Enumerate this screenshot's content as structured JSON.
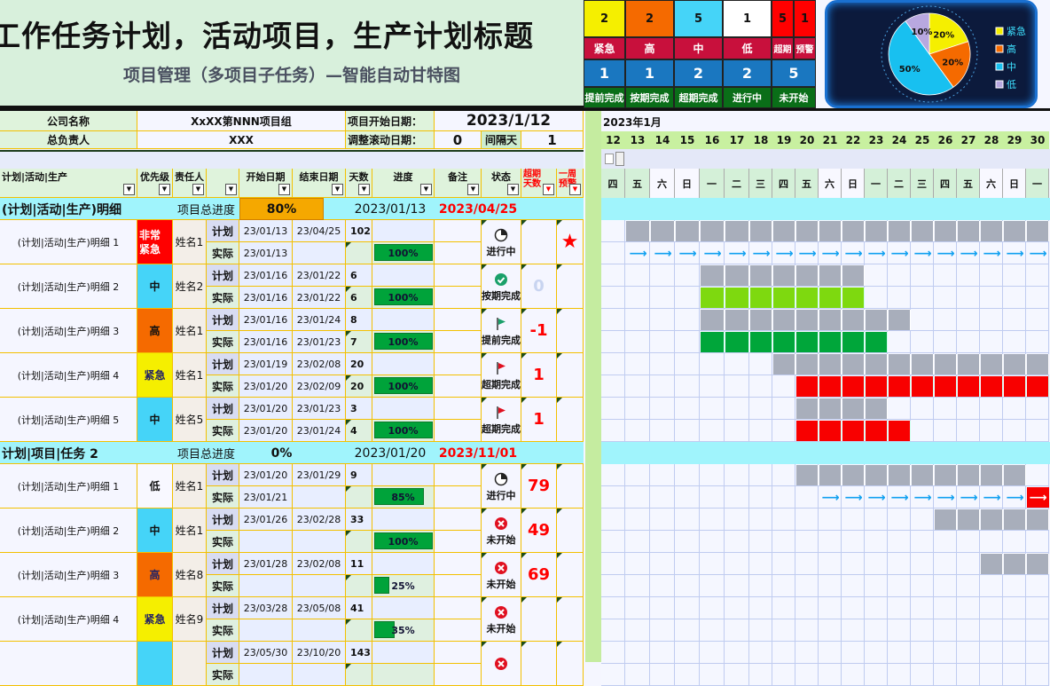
{
  "title": {
    "main": "工作任务计划，活动项目，生产计划标题",
    "sub": "项目管理（多项目子任务）—智能自动甘特图"
  },
  "stats": {
    "priority": [
      {
        "label": "紧急",
        "count": "2",
        "color": "#f5ef00"
      },
      {
        "label": "高",
        "count": "2",
        "color": "#f56a00"
      },
      {
        "label": "中",
        "count": "5",
        "color": "#45d4f8"
      },
      {
        "label": "低",
        "count": "1",
        "color": "#ffffff"
      },
      {
        "label": "超期",
        "count": "5",
        "color": "#ff0000"
      },
      {
        "label": "预警",
        "count": "1",
        "color": "#ff0000"
      }
    ],
    "status": [
      {
        "label": "提前完成",
        "count": "1"
      },
      {
        "label": "按期完成",
        "count": "1"
      },
      {
        "label": "超期完成",
        "count": "2"
      },
      {
        "label": "进行中",
        "count": "2"
      },
      {
        "label": "未开始",
        "count": "5"
      }
    ]
  },
  "pie": {
    "type": "pie",
    "slices": [
      {
        "name": "紧急",
        "value": 20,
        "label": "20%",
        "color": "#f5ef00"
      },
      {
        "name": "高",
        "value": 20,
        "label": "20%",
        "color": "#f56a00"
      },
      {
        "name": "中",
        "value": 50,
        "label": "50%",
        "color": "#18c0f0"
      },
      {
        "name": "低",
        "value": 10,
        "label": "10%",
        "color": "#b8a8e0"
      }
    ]
  },
  "info": {
    "company_label": "公司名称",
    "company": "XxXX第NNN项目组",
    "start_label": "项目开始日期：",
    "start_date": "2023/1/12",
    "manager_label": "总负责人",
    "manager": "XXX",
    "scroll_label": "调整滚动日期：",
    "scroll": "0",
    "interval_label": "间隔天",
    "interval": "1"
  },
  "columns": [
    "计划|活动|生产",
    "优先级",
    "责任人",
    "",
    "开始日期",
    "结束日期",
    "天数",
    "进度",
    "备注",
    "状态",
    "超期天数",
    "一周预警"
  ],
  "row_types": {
    "plan": "计划",
    "actual": "实际"
  },
  "gantt": {
    "month": "2023年1月",
    "year": 2023,
    "month_num": 1,
    "days": [
      "12",
      "13",
      "14",
      "15",
      "16",
      "17",
      "18",
      "19",
      "20",
      "21",
      "22",
      "23",
      "24",
      "25",
      "26",
      "27",
      "28",
      "29",
      "30"
    ],
    "weekdays": [
      "四",
      "五",
      "六",
      "日",
      "一",
      "二",
      "三",
      "四",
      "五",
      "六",
      "日",
      "一",
      "二",
      "三",
      "四",
      "五",
      "六",
      "日",
      "一"
    ]
  },
  "colors": {
    "plan_bar": "#a8aebb",
    "ontime": "#7ed90f",
    "early": "#00a63a",
    "late": "#f80000",
    "progress": "#00a33a"
  },
  "groups": [
    {
      "name": "(计划|活动|生产)明细",
      "progress_label": "项目总进度",
      "progress": "80%",
      "progress_box": true,
      "start": "2023/01/13",
      "end": "2023/04/25",
      "tasks": [
        {
          "name": "(计划|活动|生产)明细 1",
          "priority": "非常紧急",
          "pcolor": "#ff0000",
          "ptext": "#ffffff",
          "person": "姓名1",
          "plan": [
            "23/01/13",
            "23/04/25",
            "102"
          ],
          "actual": [
            "23/01/13",
            "",
            ""
          ],
          "progress": "100%",
          "pv": 100,
          "status": "进行中",
          "icon": "clock-pie",
          "overdue": "",
          "ocolor": "#ff0000",
          "warning": "★"
        },
        {
          "name": "(计划|活动|生产)明细 2",
          "priority": "中",
          "pcolor": "#45d4f8",
          "ptext": "#111111",
          "person": "姓名2",
          "plan": [
            "23/01/16",
            "23/01/22",
            "6"
          ],
          "actual": [
            "23/01/16",
            "23/01/22",
            "6"
          ],
          "progress": "100%",
          "pv": 100,
          "status": "按期完成",
          "icon": "check-circle",
          "overdue": "0",
          "ocolor": "#c8d4f0",
          "warning": ""
        },
        {
          "name": "(计划|活动|生产)明细 3",
          "priority": "高",
          "pcolor": "#f56a00",
          "ptext": "#111111",
          "person": "姓名1",
          "plan": [
            "23/01/16",
            "23/01/24",
            "8"
          ],
          "actual": [
            "23/01/16",
            "23/01/23",
            "7"
          ],
          "progress": "100%",
          "pv": 100,
          "status": "提前完成",
          "icon": "flag-green",
          "overdue": "-1",
          "ocolor": "#ff0000",
          "warning": ""
        },
        {
          "name": "(计划|活动|生产)明细 4",
          "priority": "紧急",
          "pcolor": "#f5ef00",
          "ptext": "#222266",
          "person": "姓名1",
          "plan": [
            "23/01/19",
            "23/02/08",
            "20"
          ],
          "actual": [
            "23/01/20",
            "23/02/09",
            "20"
          ],
          "progress": "100%",
          "pv": 100,
          "status": "超期完成",
          "icon": "flag-red",
          "overdue": "1",
          "ocolor": "#ff0000",
          "warning": ""
        },
        {
          "name": "(计划|活动|生产)明细 5",
          "priority": "中",
          "pcolor": "#45d4f8",
          "ptext": "#111111",
          "person": "姓名5",
          "plan": [
            "23/01/20",
            "23/01/23",
            "3"
          ],
          "actual": [
            "23/01/20",
            "23/01/24",
            "4"
          ],
          "progress": "100%",
          "pv": 100,
          "status": "超期完成",
          "icon": "flag-red",
          "overdue": "1",
          "ocolor": "#ff0000",
          "warning": ""
        }
      ]
    },
    {
      "name": "计划|项目|任务 2",
      "progress_label": "项目总进度",
      "progress": "0%",
      "progress_box": false,
      "start": "2023/01/20",
      "end": "2023/11/01",
      "tasks": [
        {
          "name": "(计划|活动|生产)明细 1",
          "priority": "低",
          "pcolor": "#f8f8ff",
          "ptext": "#111111",
          "person": "姓名1",
          "plan": [
            "23/01/20",
            "23/01/29",
            "9"
          ],
          "actual": [
            "23/01/21",
            "",
            ""
          ],
          "progress": "85%",
          "pv": 85,
          "status": "进行中",
          "icon": "clock-pie",
          "overdue": "79",
          "ocolor": "#ff0000",
          "warning": ""
        },
        {
          "name": "(计划|活动|生产)明细 2",
          "priority": "中",
          "pcolor": "#45d4f8",
          "ptext": "#111111",
          "person": "姓名1",
          "plan": [
            "23/01/26",
            "23/02/28",
            "33"
          ],
          "actual": [
            "",
            "",
            ""
          ],
          "progress": "100%",
          "pv": 100,
          "status": "未开始",
          "icon": "x-circle",
          "overdue": "49",
          "ocolor": "#ff0000",
          "warning": ""
        },
        {
          "name": "(计划|活动|生产)明细 3",
          "priority": "高",
          "pcolor": "#f56a00",
          "ptext": "#222266",
          "person": "姓名8",
          "plan": [
            "23/01/28",
            "23/02/08",
            "11"
          ],
          "actual": [
            "",
            "",
            ""
          ],
          "progress": "25%",
          "pv": 25,
          "status": "未开始",
          "icon": "x-circle",
          "overdue": "69",
          "ocolor": "#ff0000",
          "warning": ""
        },
        {
          "name": "(计划|活动|生产)明细 4",
          "priority": "紧急",
          "pcolor": "#f5ef00",
          "ptext": "#222266",
          "person": "姓名9",
          "plan": [
            "23/03/28",
            "23/05/08",
            "41"
          ],
          "actual": [
            "",
            "",
            ""
          ],
          "progress": "35%",
          "pv": 35,
          "status": "未开始",
          "icon": "x-circle",
          "overdue": "",
          "ocolor": "#ff0000",
          "warning": ""
        },
        {
          "name": "",
          "priority": "",
          "pcolor": "#45d4f8",
          "ptext": "#111111",
          "person": "",
          "plan": [
            "23/05/30",
            "23/10/20",
            "143"
          ],
          "actual": [
            "",
            "",
            ""
          ],
          "progress": "",
          "pv": 0,
          "status": "",
          "icon": "x-circle",
          "overdue": "",
          "ocolor": "#ff0000",
          "warning": ""
        }
      ]
    }
  ]
}
